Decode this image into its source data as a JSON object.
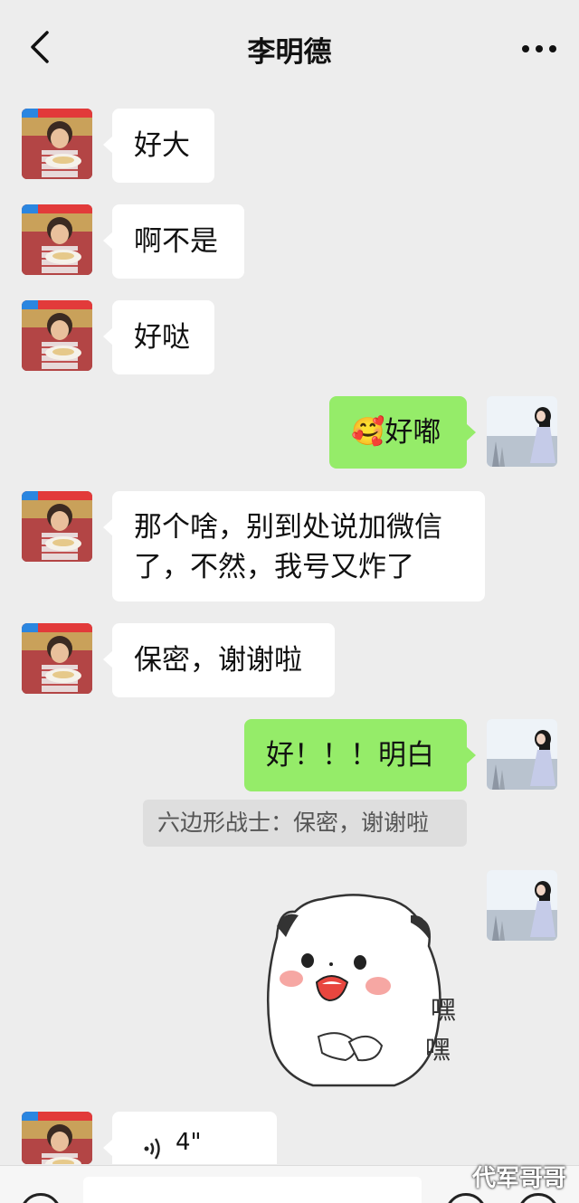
{
  "header": {
    "title": "李明德"
  },
  "messages": [
    {
      "side": "left",
      "text": "好大"
    },
    {
      "side": "left",
      "text": "啊不是"
    },
    {
      "side": "left",
      "text": "好哒"
    },
    {
      "side": "right",
      "emoji": "🥰",
      "text": "好嘟"
    },
    {
      "side": "left",
      "line1": "那个啥，别到处说加微信",
      "line2": "了，不然，我号又炸了"
    },
    {
      "side": "left",
      "text": "保密，谢谢啦"
    },
    {
      "side": "right",
      "text": "好！！！明白"
    },
    {
      "side": "right",
      "type": "sticker",
      "sticker_text_1": "嘿",
      "sticker_text_2": "嘿"
    },
    {
      "side": "left",
      "type": "voice",
      "duration": "4\""
    }
  ],
  "quote": {
    "text": "六边形战士：保密，谢谢啦"
  },
  "watermark": "代军哥哥",
  "colors": {
    "background": "#ededed",
    "sent_bubble": "#95ec69",
    "received_bubble": "#ffffff",
    "quote_bg": "#dedede"
  }
}
